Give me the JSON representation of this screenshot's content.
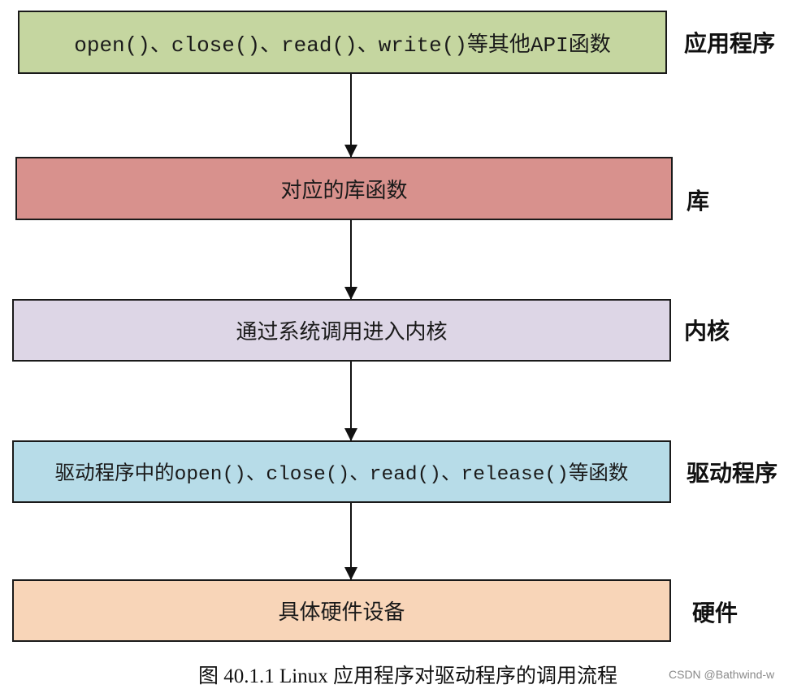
{
  "diagram": {
    "boxes": [
      {
        "text": "open()、close()、read()、write()等其他API函数",
        "layer": "应用程序",
        "color": "#c5d6a0"
      },
      {
        "text": "对应的库函数",
        "layer": "库",
        "color": "#d8918d"
      },
      {
        "text": "通过系统调用进入内核",
        "layer": "内核",
        "color": "#ddd6e6"
      },
      {
        "text": "驱动程序中的open()、close()、read()、release()等函数",
        "layer": "驱动程序",
        "color": "#b7dce8"
      },
      {
        "text": "具体硬件设备",
        "layer": "硬件",
        "color": "#f8d5b8"
      }
    ],
    "arrows": [
      {
        "from": 0,
        "to": 1
      },
      {
        "from": 1,
        "to": 2
      },
      {
        "from": 2,
        "to": 3
      },
      {
        "from": 3,
        "to": 4
      }
    ]
  },
  "caption": "图 40.1.1 Linux 应用程序对驱动程序的调用流程",
  "watermark": "CSDN @Bathwind-w"
}
